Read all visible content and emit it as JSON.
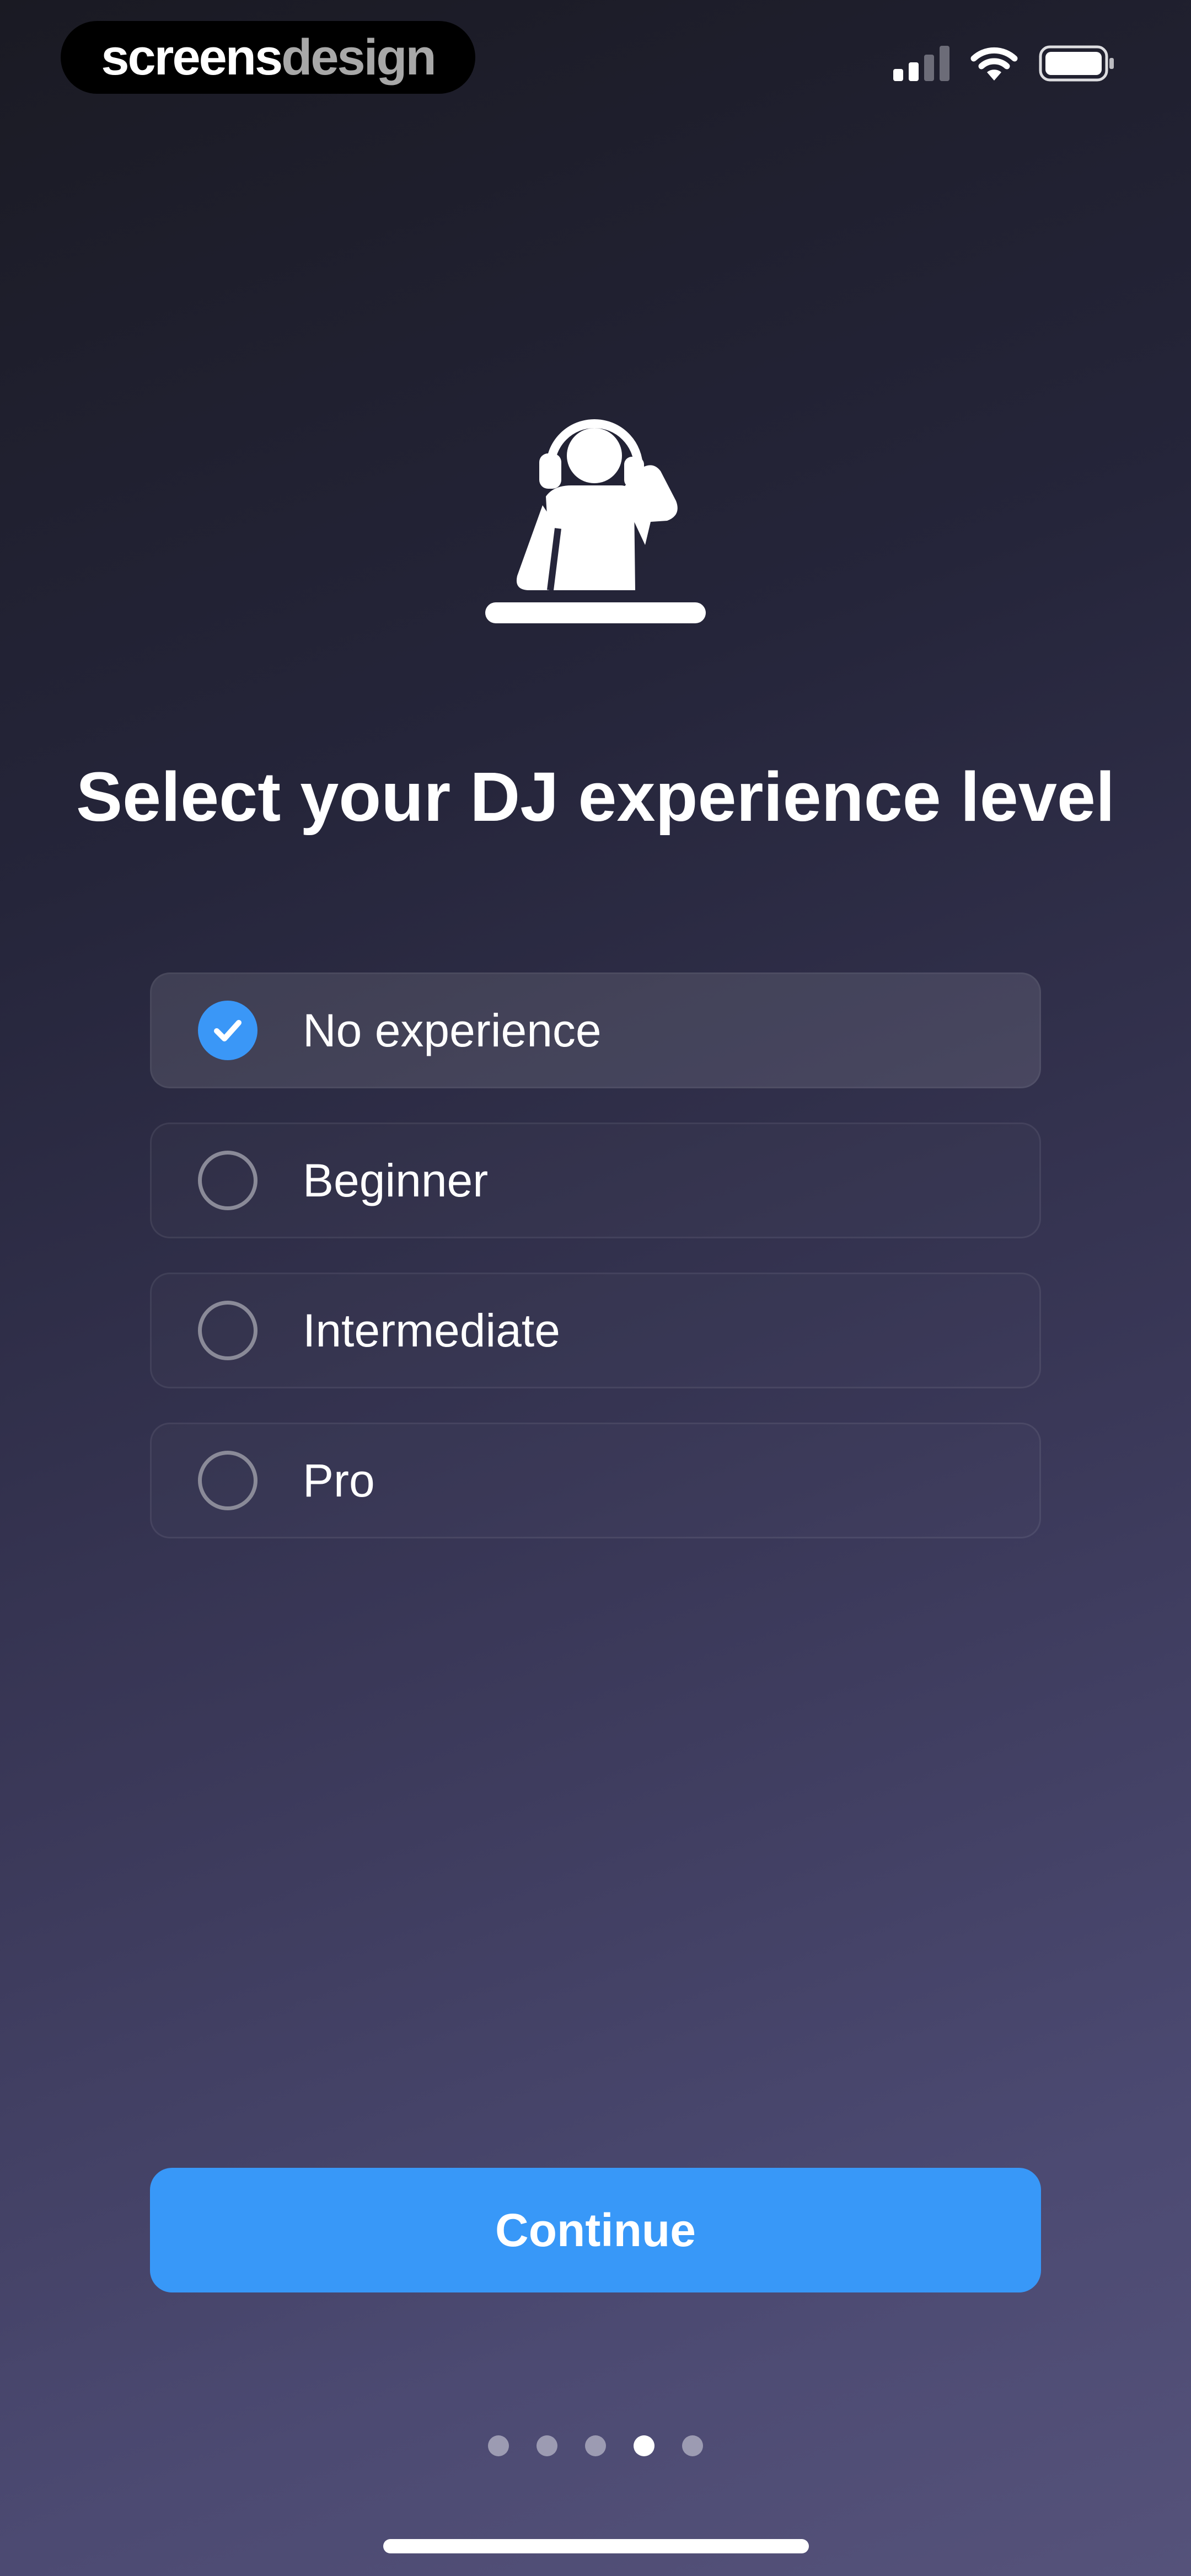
{
  "watermark": {
    "part1": "screens",
    "part2": "design"
  },
  "status_bar": {
    "icons": [
      "cellular-signal-icon",
      "wifi-icon",
      "battery-icon"
    ]
  },
  "hero": {
    "icon": "dj-headphones-icon"
  },
  "title": "Select your DJ experience level",
  "options": [
    {
      "label": "No experience",
      "selected": true
    },
    {
      "label": "Beginner",
      "selected": false
    },
    {
      "label": "Intermediate",
      "selected": false
    },
    {
      "label": "Pro",
      "selected": false
    }
  ],
  "continue_label": "Continue",
  "pagination": {
    "total": 5,
    "current": 4
  },
  "colors": {
    "accent": "#3898f8",
    "checked": "#3a97f7",
    "radio_border": "#8a8a98",
    "dot_inactive": "#9c9bb2",
    "dot_active": "#ffffff"
  }
}
